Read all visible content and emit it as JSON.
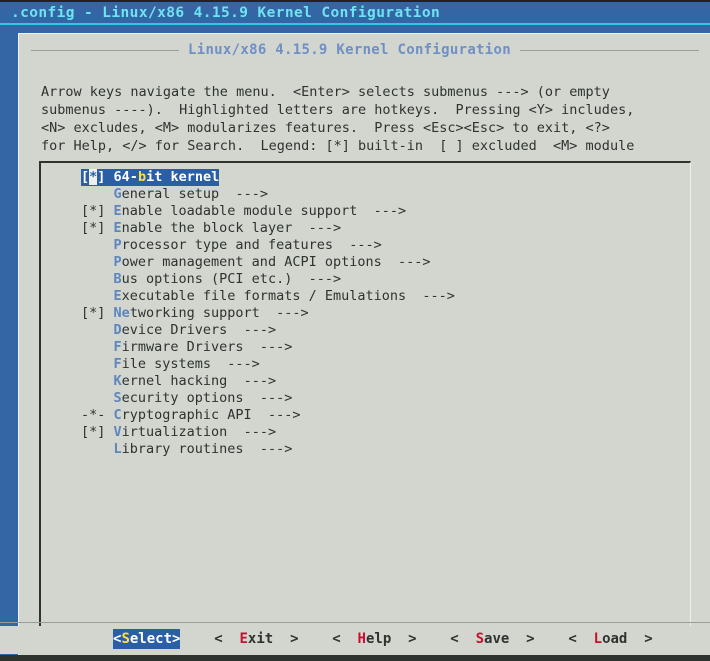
{
  "window": {
    "title": ".config - Linux/x86 4.15.9 Kernel Configuration"
  },
  "dialog": {
    "title": "Linux/x86 4.15.9 Kernel Configuration",
    "help_lines": [
      "Arrow keys navigate the menu.  <Enter> selects submenus ---> (or empty",
      "submenus ----).  Highlighted letters are hotkeys.  Pressing <Y> includes,",
      "<N> excludes, <M> modularizes features.  Press <Esc><Esc> to exit, <?>",
      "for Help, </> for Search.  Legend: [*] built-in  [ ] excluded  <M> module"
    ]
  },
  "menu": {
    "selected_index": 0,
    "items": [
      {
        "mark": "[*]",
        "hotkey": "b",
        "pre": "64-",
        "post": "it kernel",
        "arrow": "",
        "selected": true
      },
      {
        "mark": "   ",
        "hotkey": "G",
        "pre": "",
        "post": "eneral setup",
        "arrow": "  --->",
        "selected": false
      },
      {
        "mark": "[*]",
        "hotkey": "E",
        "pre": "",
        "post": "nable loadable module support",
        "arrow": "  --->",
        "selected": false
      },
      {
        "mark": "[*]",
        "hotkey": "E",
        "pre": "",
        "post": "nable the block layer",
        "arrow": "  --->",
        "selected": false
      },
      {
        "mark": "   ",
        "hotkey": "P",
        "pre": "",
        "post": "rocessor type and features",
        "arrow": "  --->",
        "selected": false
      },
      {
        "mark": "   ",
        "hotkey": "P",
        "pre": "",
        "post": "ower management and ACPI options",
        "arrow": "  --->",
        "selected": false
      },
      {
        "mark": "   ",
        "hotkey": "B",
        "pre": "",
        "post": "us options (PCI etc.)",
        "arrow": "  --->",
        "selected": false
      },
      {
        "mark": "   ",
        "hotkey": "E",
        "pre": "",
        "post": "xecutable file formats / Emulations",
        "arrow": "  --->",
        "selected": false
      },
      {
        "mark": "[*]",
        "hotkey": "Ne",
        "pre": "",
        "post": "tworking support",
        "arrow": "  --->",
        "selected": false
      },
      {
        "mark": "   ",
        "hotkey": "D",
        "pre": "",
        "post": "evice Drivers",
        "arrow": "  --->",
        "selected": false
      },
      {
        "mark": "   ",
        "hotkey": "F",
        "pre": "",
        "post": "irmware Drivers",
        "arrow": "  --->",
        "selected": false
      },
      {
        "mark": "   ",
        "hotkey": "F",
        "pre": "",
        "post": "ile systems",
        "arrow": "  --->",
        "selected": false
      },
      {
        "mark": "   ",
        "hotkey": "K",
        "pre": "",
        "post": "ernel hacking",
        "arrow": "  --->",
        "selected": false
      },
      {
        "mark": "   ",
        "hotkey": "S",
        "pre": "",
        "post": "ecurity options",
        "arrow": "  --->",
        "selected": false
      },
      {
        "mark": "-*-",
        "hotkey": "C",
        "pre": "",
        "post": "ryptographic API",
        "arrow": "  --->",
        "selected": false
      },
      {
        "mark": "[*]",
        "hotkey": "V",
        "pre": "",
        "post": "irtualization",
        "arrow": "  --->",
        "selected": false
      },
      {
        "mark": "   ",
        "hotkey": "L",
        "pre": "",
        "post": "ibrary routines",
        "arrow": "  --->",
        "selected": false
      }
    ]
  },
  "buttons": [
    {
      "open": "<",
      "hk": "S",
      "rest": "elect",
      "close": ">",
      "active": true
    },
    {
      "open": "<  ",
      "hk": "E",
      "rest": "xit",
      "close": "  >",
      "active": false
    },
    {
      "open": "<  ",
      "hk": "H",
      "rest": "elp",
      "close": "  >",
      "active": false
    },
    {
      "open": "<  ",
      "hk": "S",
      "rest": "ave",
      "close": "  >",
      "active": false
    },
    {
      "open": "<  ",
      "hk": "L",
      "rest": "oad",
      "close": "  >",
      "active": false
    }
  ],
  "colors": {
    "desktop_blue": "#3465a4",
    "titlebar_text": "#6fe3ef",
    "accent_cyan": "#34c6e0",
    "dialog_bg": "#d2d6cf",
    "dialog_title": "#6f8fc6",
    "hotkey_blue": "#5d86bf",
    "selection_bg": "#2a5fa5",
    "selection_hotkey": "#ffe23d",
    "button_hotkey_red": "#c8102e",
    "text": "#2f3330"
  }
}
